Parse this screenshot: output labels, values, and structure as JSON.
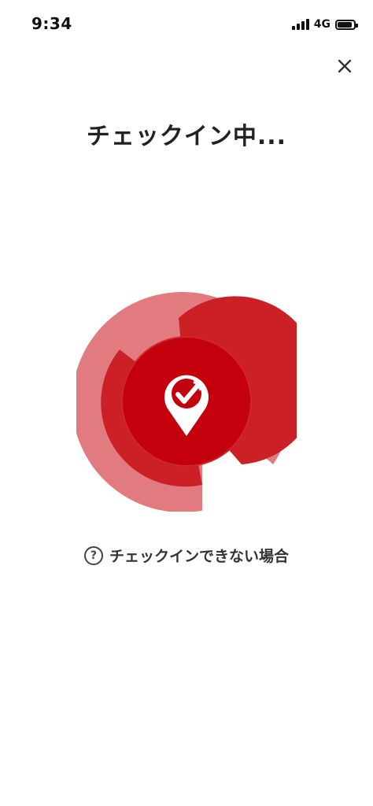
{
  "status_bar": {
    "time": "9:34",
    "network": "4G"
  },
  "header": {
    "title": "チェックイン中..."
  },
  "help": {
    "label": "チェックインできない場合",
    "icon_glyph": "?"
  },
  "colors": {
    "brand_red": "#c4000d",
    "mid_red": "#cc2027",
    "light_red": "#e27b80",
    "text_dark": "#222222"
  },
  "icons": {
    "close": "close-icon",
    "help": "question-circle-icon",
    "checkin": "location-pin-check-icon"
  }
}
